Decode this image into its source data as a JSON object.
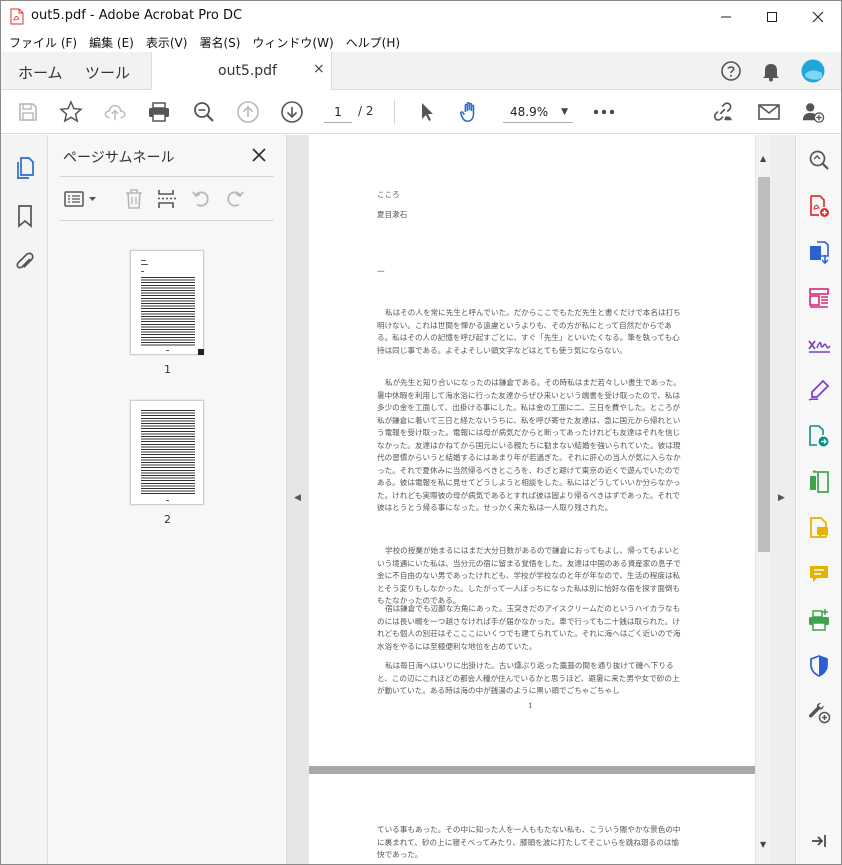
{
  "window": {
    "title": "out5.pdf - Adobe Acrobat Pro DC"
  },
  "menu": [
    "ファイル (F)",
    "編集 (E)",
    "表示(V)",
    "署名(S)",
    "ウィンドウ(W)",
    "ヘルプ(H)"
  ],
  "tabs": {
    "home": "ホーム",
    "tools": "ツール",
    "document": "out5.pdf",
    "close": "×"
  },
  "toolbar": {
    "page_current": "1",
    "page_total": "/ 2",
    "zoom": "48.9%"
  },
  "thumbnails": {
    "title": "ページサムネール",
    "pages": [
      {
        "label": "1"
      },
      {
        "label": "2"
      }
    ]
  },
  "document": {
    "page1": {
      "heading": "こころ",
      "author": "夏目漱石",
      "section": "一",
      "paragraphs": [
        "私はその人を常に先生と呼んでいた。だからここでもただ先生と書くだけで本名は打ち明けない。これは世間を憚かる遠慮というよりも、その方が私にとって自然だからである。私はその人の記憶を呼び起すごとに、すぐ「先生」といいたくなる。筆を執っても心持は同じ事である。よそよそしい頭文字などはとても使う気にならない。",
        "私が先生と知り合いになったのは鎌倉である。その時私はまだ若々しい書生であった。暑中休暇を利用して海水浴に行った友達からぜひ来いという端書を受け取ったので、私は多少の金を工面して、出掛ける事にした。私は金の工面に二、三日を費やした。ところが私が鎌倉に着いて三日と経たないうちに、私を呼び寄せた友達は、急に国元から帰れという電報を受け取った。電報には母が病気だからと断ってあったけれども友達はそれを信じなかった。友達はかねてから国元にいる親たちに勧まない結婚を強いられていた。彼は現代の習慣からいうと結婚するにはあまり年が若過ぎた。それに肝心の当人が気に入らなかった。それで夏休みに当然帰るべきところを、わざと避けて東京の近くで遊んでいたのである。彼は電報を私に見せてどうしようと相談をした。私にはどうしていいか分らなかった。けれども実際彼の母が病気であるとすれば彼は固より帰るべきはずであった。それで彼はとうとう帰る事になった。せっかく来た私は一人取り残された。",
        "学校の授業が始まるにはまだ大分日数があるので鎌倉におってもよし、帰ってもよいという境遇にいた私は、当分元の宿に留まる覚悟をした。友達は中国のある資産家の息子で金に不自由のない男であったけれども、学校が学校なのと年が年なので、生活の程度は私とそう変りもしなかった。したがって一人ぼっちになった私は別に恰好な宿を探す面倒ももたなかったのである。",
        "宿は鎌倉でも辺鄙な方角にあった。玉突きだのアイスクリームだのというハイカラなものには長い畷を一つ越さなければ手が届かなかった。車で行っても二十銭は取られた。けれども個人の別荘はそこここにいくつでも建てられていた。それに海へはごく近いので海水浴をやるには至極便利な地位を占めていた。",
        "私は毎日海へはいりに出掛けた。古い燻ぶり返った藁葺の間を通り抜けて磯へ下りると、この辺にこれほどの都会人種が住んでいるかと思うほど、避暑に来た男や女で砂の上が動いていた。ある時は海の中が銭湯のように黒い頭でごちゃごちゃし"
      ],
      "page_number": "1"
    },
    "page2": {
      "text": "ている事もあった。その中に知った人を一人ももたない私も、こういう賑やかな景色の中に裹まれて、砂の上に寝そべってみたり、膝頭を波に打たしてそこいらを跳ね廻るのは愉快であった。"
    }
  },
  "colors": {
    "accent_blue": "#2c6ecb",
    "acrobat_red": "#e0322c",
    "avatar": "#1fa7dc"
  }
}
